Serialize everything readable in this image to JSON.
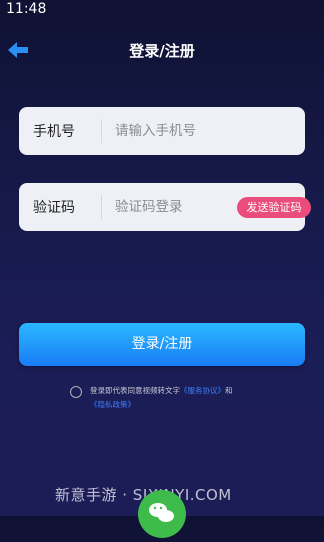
{
  "status": {
    "time": "11:48"
  },
  "nav": {
    "title": "登录/注册"
  },
  "phone": {
    "label": "手机号",
    "placeholder": "请输入手机号"
  },
  "code": {
    "label": "验证码",
    "placeholder": "验证码登录",
    "send_label": "发送验证码"
  },
  "submit": {
    "label": "登录/注册"
  },
  "agreement": {
    "text": "登录即代表同意视频转文字",
    "service_link": "《服务协议》",
    "and": "和",
    "privacy_link": "《隐私政策》"
  },
  "watermark": {
    "text": "新意手游 · SJXINYI.COM"
  },
  "colors": {
    "accent": "#1a7cf6",
    "send_code": "#ea4c7c",
    "wechat": "#3fbb4c"
  }
}
